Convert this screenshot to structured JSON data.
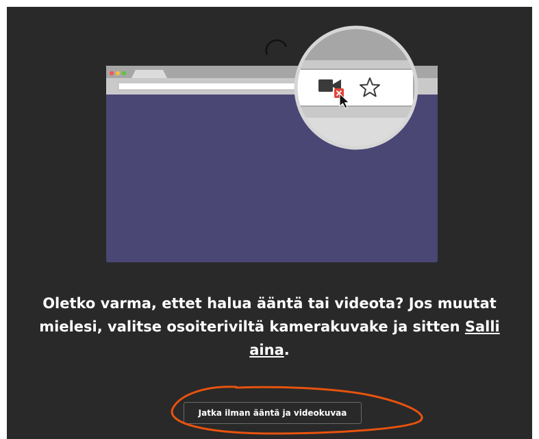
{
  "dialog": {
    "message_part1": "Oletko varma, ettet halua ääntä tai videota? Jos muutat mielesi, valitse osoiteriviltä kamerakuvake ja sitten ",
    "message_link": "Salli aina",
    "message_end": ".",
    "continue_button_label": "Jatka ilman ääntä ja videokuvaa"
  },
  "illustration": {
    "browser_content_color": "#4a4775",
    "annotation_color": "#e8530e",
    "icons": [
      "camera-blocked-icon",
      "star-icon",
      "cursor-icon"
    ]
  }
}
